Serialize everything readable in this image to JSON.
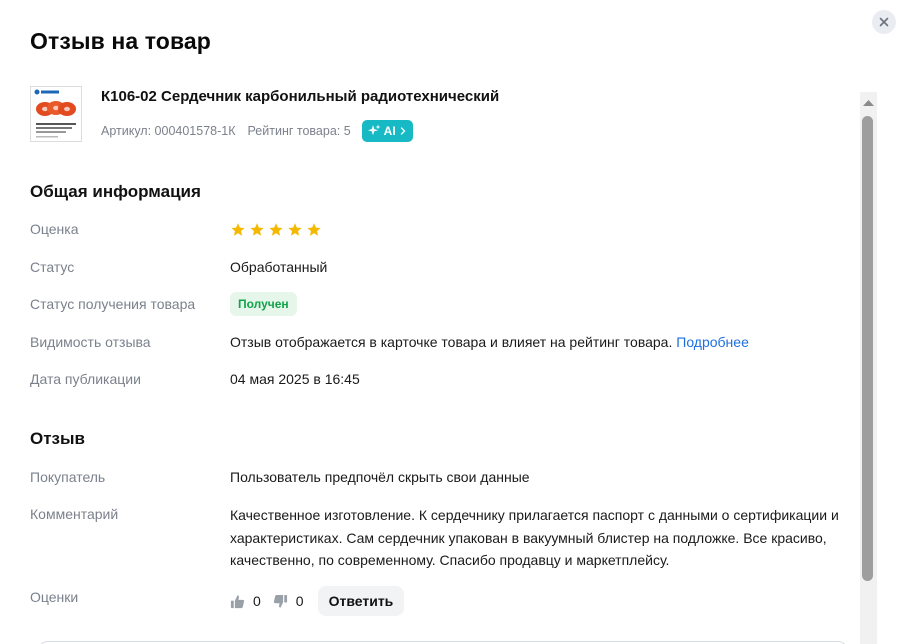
{
  "modal": {
    "title": "Отзыв на товар"
  },
  "product": {
    "name": "К106-02 Сердечник карбонильный радиотехнический",
    "sku": "Артикул: 000401578-1К",
    "rating": "Рейтинг товара: 5",
    "ai_label": "AI"
  },
  "general": {
    "title": "Общая информация",
    "rating_label": "Оценка",
    "rating_value": 5,
    "rating_max": 5,
    "status_label": "Статус",
    "status_value": "Обработанный",
    "receive_label": "Статус получения товара",
    "receive_value": "Получен",
    "visibility_label": "Видимость отзыва",
    "visibility_value": "Отзыв отображается в карточке товара и влияет на рейтинг товара.",
    "visibility_link": "Подробнее",
    "date_label": "Дата публикации",
    "date_value": "04 мая 2025 в 16:45"
  },
  "review": {
    "title": "Отзыв",
    "buyer_label": "Покупатель",
    "buyer_value": "Пользователь предпочёл скрыть свои данные",
    "comment_label": "Комментарий",
    "comment_value": "Качественное изготовление. К сердечнику прилагается паспорт с данными о сертификации и характеристиках. Сам сердечник упакован в вакуумный блистер на подложке. Все красиво, качественно, по современному. Спасибо продавцу и маркетплейсу.",
    "votes_label": "Оценки",
    "likes": "0",
    "dislikes": "0",
    "reply_label": "Ответить"
  },
  "colors": {
    "accent": "#16b9c4",
    "star": "#f5b800",
    "success": "#11a34a",
    "link": "#1e6fe0"
  },
  "icons": [
    "close-icon",
    "sparkle-icon",
    "chevron-right-icon",
    "star-icon",
    "thumbs-up-icon",
    "thumbs-down-icon",
    "scroll-up-arrow-icon"
  ]
}
